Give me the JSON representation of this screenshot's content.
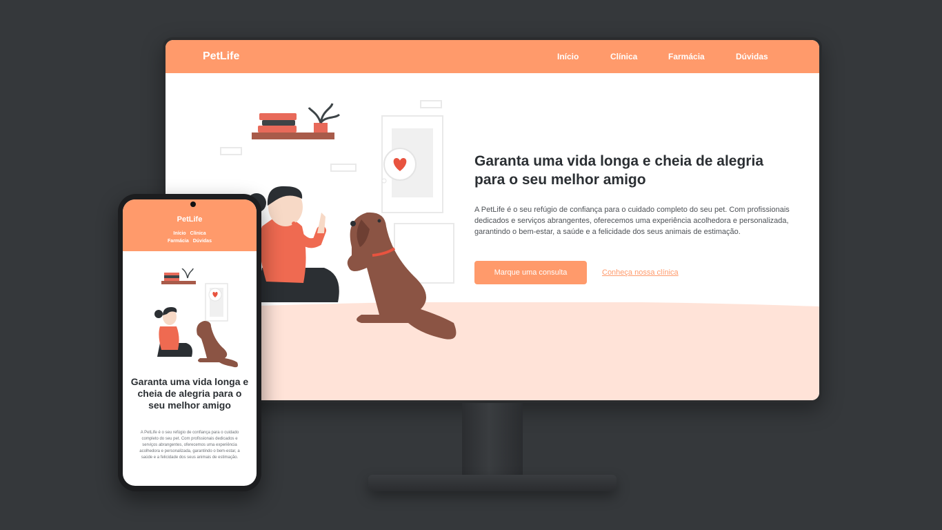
{
  "desktop": {
    "nav": {
      "logo": "PetLife",
      "items": [
        {
          "label": "Início"
        },
        {
          "label": "Clínica"
        },
        {
          "label": "Farmácia"
        },
        {
          "label": "Dúvidas"
        }
      ]
    },
    "hero": {
      "title": "Garanta uma vida longa e cheia de alegria para o seu melhor amigo",
      "description": "A PetLife é o seu refúgio de confiança para o cuidado completo do seu pet. Com profissionais dedicados e serviços abrangentes, oferecemos uma experiência acolhedora e personalizada, garantindo o bem-estar, a saúde e a felicidade dos seus animais de estimação.",
      "primary_button": "Marque uma consulta",
      "secondary_link": "Conheça nossa clínica"
    }
  },
  "mobile": {
    "nav": {
      "logo": "PetLife",
      "items": [
        {
          "label": "Início"
        },
        {
          "label": "Clínica"
        },
        {
          "label": "Farmácia"
        },
        {
          "label": "Dúvidas"
        }
      ]
    },
    "hero": {
      "title": "Garanta uma vida longa e cheia de alegria para o seu melhor amigo",
      "description": "A PetLife é o seu refúgio de confiança para o cuidado completo do seu pet. Com profissionais dedicados e serviços abrangentes, oferecemos uma experiência acolhedora e personalizada, garantindo o bem-estar, a saúde e a felicidade dos seus animais de estimação."
    }
  },
  "colors": {
    "brand": "#ff9a6b",
    "background": "#35383b",
    "floor": "#ffe3d8",
    "heading": "#2b2f33"
  }
}
